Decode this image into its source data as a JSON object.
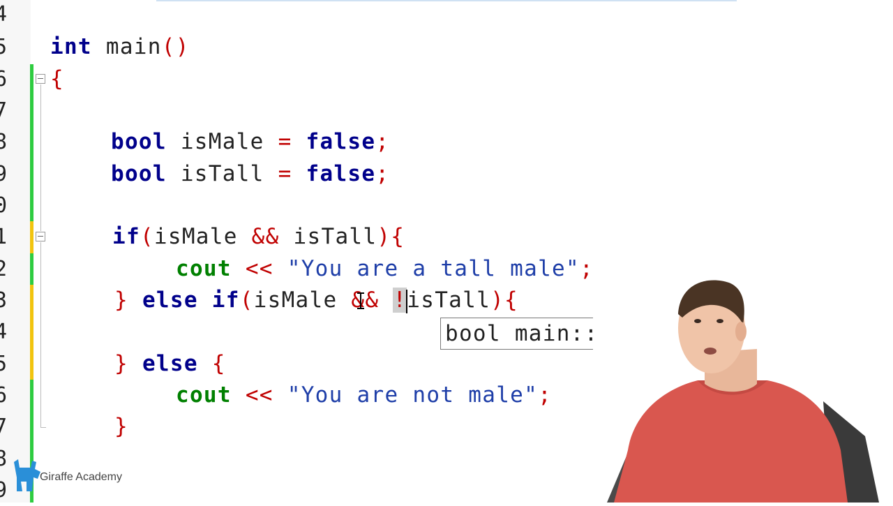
{
  "gutter": {
    "line_numbers": [
      "4",
      "5",
      "6",
      "7",
      "8",
      "9",
      "0",
      "1",
      "2",
      "3",
      "4",
      "5",
      "6",
      "7",
      "8",
      "9"
    ]
  },
  "code": {
    "line5": {
      "kw": "int",
      "rest": " main",
      "paren": "()"
    },
    "line6": {
      "brace": "{"
    },
    "line8": {
      "kw": "bool",
      "id": " isMale ",
      "eq": "=",
      "space": " ",
      "val": "false",
      "semi": ";"
    },
    "line9": {
      "kw": "bool",
      "id": " isTall ",
      "eq": "=",
      "space": " ",
      "val": "false",
      "semi": ";"
    },
    "line11": {
      "kw": "if",
      "p1": "(",
      "a": "isMale ",
      "and": "&&",
      "b": " isTall",
      "p2": "){"
    },
    "line12": {
      "cout": "cout",
      "sp": " ",
      "op": "<<",
      "sp2": " ",
      "str": "\"You are a tall male\"",
      "semi": ";"
    },
    "line13": {
      "brace": "}",
      "sp": " ",
      "kw": "else if",
      "p1": "(",
      "a": "isMale ",
      "and": "&&",
      "sp2": " ",
      "not": "!",
      "b": "isTall",
      "p2": "){"
    },
    "line15": {
      "brace": "}",
      "sp": " ",
      "kw": "else",
      "sp2": " ",
      "brace2": "{"
    },
    "line16": {
      "cout": "cout",
      "sp": " ",
      "op": "<<",
      "sp2": " ",
      "str": "\"You are not male\"",
      "semi": ";"
    },
    "line17": {
      "brace": "}"
    }
  },
  "tooltip": {
    "text": "bool main::isTa"
  },
  "watermark": {
    "text": "Giraffe Academy"
  },
  "colors": {
    "keyword": "#00008b",
    "operator": "#c00000",
    "string": "#1e3ea8",
    "cout": "#008000",
    "changed": "#2ecc40",
    "modified": "#f1c40f"
  }
}
